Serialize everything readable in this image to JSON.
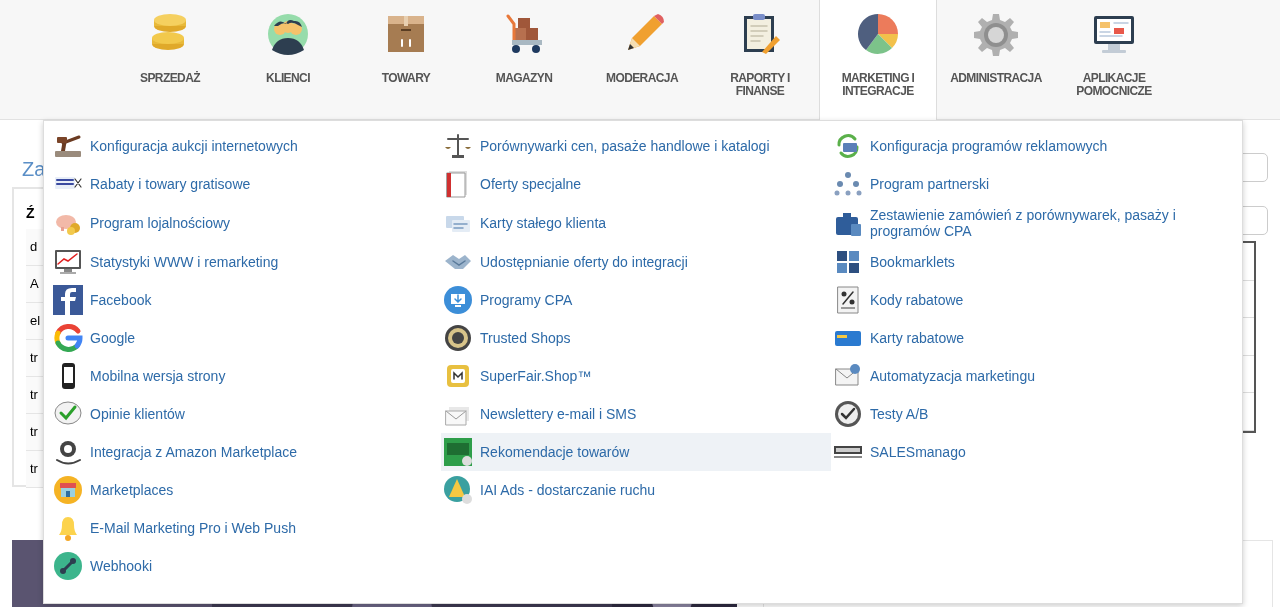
{
  "nav": [
    {
      "label": "SPRZEDAŻ",
      "selected": false
    },
    {
      "label": "KLIENCI",
      "selected": false
    },
    {
      "label": "TOWARY",
      "selected": false
    },
    {
      "label": "MAGAZYN",
      "selected": false
    },
    {
      "label": "MODERACJA",
      "selected": false
    },
    {
      "label": "RAPORTY I FINANSE",
      "selected": false
    },
    {
      "label": "MARKETING I INTEGRACJE",
      "selected": true
    },
    {
      "label": "ADMINISTRACJA",
      "selected": false
    },
    {
      "label": "APLIKACJE POMOCNICZE",
      "selected": false
    }
  ],
  "background": {
    "title": "Za",
    "table_header": "Ź",
    "cells": [
      "d",
      "A",
      "el",
      "tr",
      "tr",
      "tr",
      "tr"
    ]
  },
  "menu": {
    "columns": [
      {
        "items": [
          {
            "label": "Konfiguracja aukcji internetowych",
            "selected": false
          },
          {
            "label": "Rabaty i towary gratisowe",
            "selected": false
          },
          {
            "label": "Program lojalnościowy",
            "selected": false
          },
          {
            "label": "Statystyki WWW i remarketing",
            "selected": false
          },
          {
            "label": "Facebook",
            "selected": false
          },
          {
            "label": "Google",
            "selected": false
          },
          {
            "label": "Mobilna wersja strony",
            "selected": false
          },
          {
            "label": "Opinie klientów",
            "selected": false
          },
          {
            "label": "Integracja z Amazon Marketplace",
            "selected": false
          },
          {
            "label": "Marketplaces",
            "selected": false
          },
          {
            "label": "E-Mail Marketing Pro i Web Push",
            "selected": false
          },
          {
            "label": "Webhooki",
            "selected": false
          }
        ]
      },
      {
        "items": [
          {
            "label": "Porównywarki cen, pasaże handlowe i katalogi",
            "selected": false
          },
          {
            "label": "Oferty specjalne",
            "selected": false
          },
          {
            "label": "Karty stałego klienta",
            "selected": false
          },
          {
            "label": "Udostępnianie oferty do integracji",
            "selected": false
          },
          {
            "label": "Programy CPA",
            "selected": false
          },
          {
            "label": "Trusted Shops",
            "selected": false
          },
          {
            "label": "SuperFair.Shop™",
            "selected": false
          },
          {
            "label": "Newslettery e-mail i SMS",
            "selected": false
          },
          {
            "label": "Rekomendacje towarów",
            "selected": true
          },
          {
            "label": "IAI Ads - dostarczanie ruchu",
            "selected": false
          }
        ]
      },
      {
        "items": [
          {
            "label": "Konfiguracja programów reklamowych",
            "selected": false
          },
          {
            "label": "Program partnerski",
            "selected": false
          },
          {
            "label": "Zestawienie zamówień z porównywarek, pasaży i programów CPA",
            "selected": false
          },
          {
            "label": "Bookmarklets",
            "selected": false
          },
          {
            "label": "Kody rabatowe",
            "selected": false
          },
          {
            "label": "Karty rabatowe",
            "selected": false
          },
          {
            "label": "Automatyzacja marketingu",
            "selected": false
          },
          {
            "label": "Testy A/B",
            "selected": false
          },
          {
            "label": "SALESmanago",
            "selected": false
          }
        ]
      }
    ]
  }
}
